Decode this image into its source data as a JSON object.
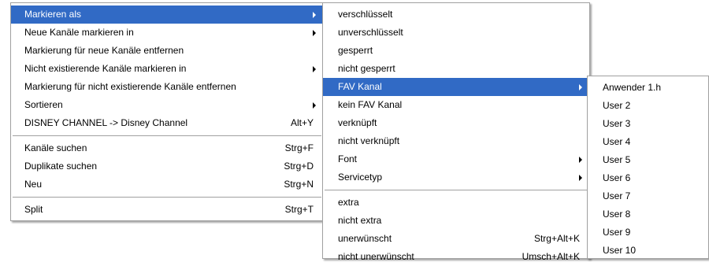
{
  "main_menu": {
    "items": [
      {
        "label": "Markieren als",
        "shortcut": "",
        "submenu": true,
        "highlighted": true
      },
      {
        "label": "Neue Kanäle markieren in",
        "shortcut": "",
        "submenu": true
      },
      {
        "label": "Markierung für neue Kanäle entfernen",
        "shortcut": "",
        "submenu": false
      },
      {
        "label": "Nicht existierende Kanäle markieren in",
        "shortcut": "",
        "submenu": true
      },
      {
        "label": "Markierung für nicht existierende Kanäle entfernen",
        "shortcut": "",
        "submenu": false
      },
      {
        "label": "Sortieren",
        "shortcut": "",
        "submenu": true
      },
      {
        "label": "DISNEY CHANNEL -> Disney Channel",
        "shortcut": "Alt+Y",
        "submenu": false
      },
      {
        "separator": true
      },
      {
        "label": "Kanäle suchen",
        "shortcut": "Strg+F",
        "submenu": false
      },
      {
        "label": "Duplikate suchen",
        "shortcut": "Strg+D",
        "submenu": false
      },
      {
        "label": "Neu",
        "shortcut": "Strg+N",
        "submenu": false
      },
      {
        "separator": true
      },
      {
        "label": "Split",
        "shortcut": "Strg+T",
        "submenu": false
      }
    ]
  },
  "mark_as_menu": {
    "items": [
      {
        "label": "verschlüsselt",
        "shortcut": "",
        "submenu": false
      },
      {
        "label": "unverschlüsselt",
        "shortcut": "",
        "submenu": false
      },
      {
        "label": "gesperrt",
        "shortcut": "",
        "submenu": false
      },
      {
        "label": "nicht gesperrt",
        "shortcut": "",
        "submenu": false
      },
      {
        "label": "FAV Kanal",
        "shortcut": "",
        "submenu": true,
        "highlighted": true
      },
      {
        "label": "kein FAV Kanal",
        "shortcut": "",
        "submenu": false
      },
      {
        "label": "verknüpft",
        "shortcut": "",
        "submenu": false
      },
      {
        "label": "nicht verknüpft",
        "shortcut": "",
        "submenu": false
      },
      {
        "label": "Font",
        "shortcut": "",
        "submenu": true
      },
      {
        "label": "Servicetyp",
        "shortcut": "",
        "submenu": true
      },
      {
        "separator": true
      },
      {
        "label": "extra",
        "shortcut": "",
        "submenu": false
      },
      {
        "label": "nicht extra",
        "shortcut": "",
        "submenu": false
      },
      {
        "label": "unerwünscht",
        "shortcut": "Strg+Alt+K",
        "submenu": false
      },
      {
        "label": "nicht unerwünscht",
        "shortcut": "Umsch+Alt+K",
        "submenu": false
      }
    ]
  },
  "fav_menu": {
    "items": [
      {
        "label": "Anwender 1.h"
      },
      {
        "label": "User 2"
      },
      {
        "label": "User 3"
      },
      {
        "label": "User 4"
      },
      {
        "label": "User 5"
      },
      {
        "label": "User 6"
      },
      {
        "label": "User 7"
      },
      {
        "label": "User 8"
      },
      {
        "label": "User 9"
      },
      {
        "label": "User 10"
      }
    ]
  },
  "colors": {
    "highlight": "#316ac5",
    "border": "#a0a0a0",
    "background": "#ffffff"
  }
}
